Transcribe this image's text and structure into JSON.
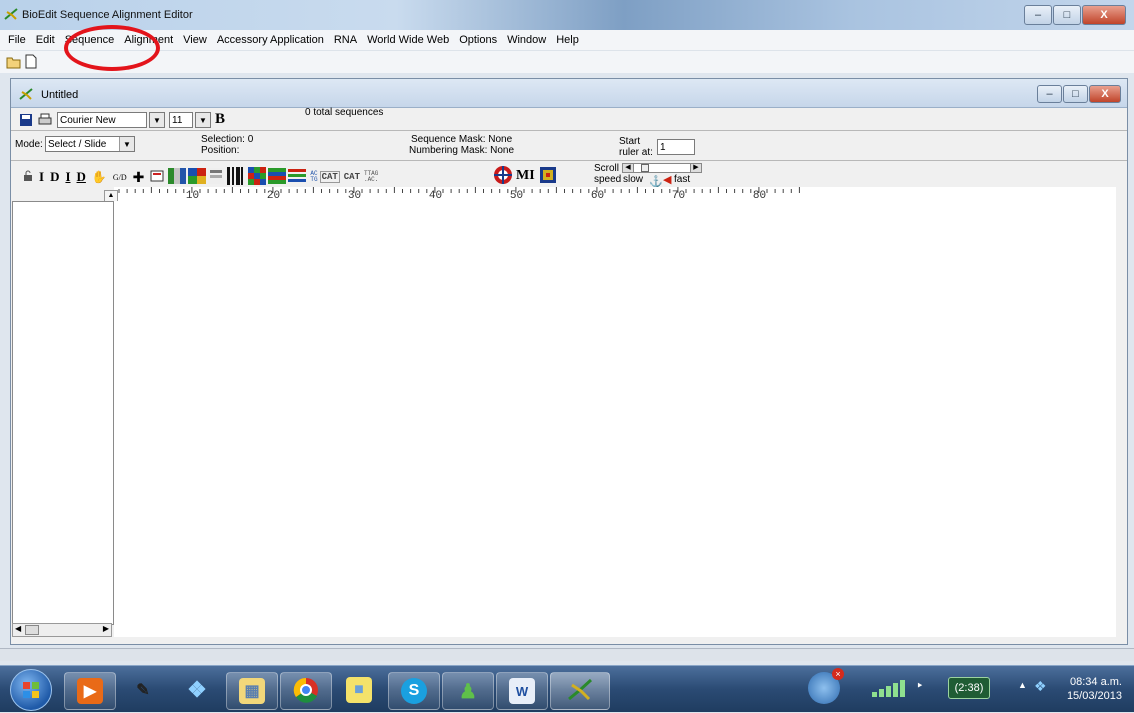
{
  "app_title": "BioEdit Sequence Alignment Editor",
  "menu": [
    "File",
    "Edit",
    "Sequence",
    "Alignment",
    "View",
    "Accessory Application",
    "RNA",
    "World Wide Web",
    "Options",
    "Window",
    "Help"
  ],
  "document": {
    "title": "Untitled",
    "font_name": "Courier New",
    "font_size": "11",
    "bold_glyph": "B",
    "total_sequences": "0 total sequences",
    "mode_label": "Mode:",
    "mode_value": "Select / Slide",
    "selection": "Selection: 0",
    "position": "Position:",
    "sequence_mask": "Sequence Mask: None",
    "numbering_mask": "Numbering Mask: None",
    "start_label": "Start",
    "ruler_at_label": "ruler at:",
    "ruler_start": "1",
    "scroll_label": "Scroll",
    "speed_label": "speed",
    "slow_label": "slow",
    "fast_label": "fast",
    "toolbar_glyphs": [
      "I",
      "D",
      "I",
      "D"
    ],
    "gd_label": "G/D",
    "mi_label": "MI"
  },
  "ruler_ticks": [
    "10",
    "20",
    "30",
    "40",
    "50",
    "60",
    "70",
    "80"
  ],
  "taskbar": {
    "time": "08:34 a.m.",
    "date": "15/03/2013",
    "battery": "(2:38)"
  },
  "colors": {
    "annotation": "#e3141b",
    "taskbar": "#2b4b74"
  },
  "icons": [
    "open-folder-icon",
    "new-file-icon",
    "save-icon",
    "print-icon",
    "lock-icon",
    "windows-start-icon",
    "chrome-icon",
    "skype-icon",
    "word-icon",
    "bioedit-icon"
  ]
}
